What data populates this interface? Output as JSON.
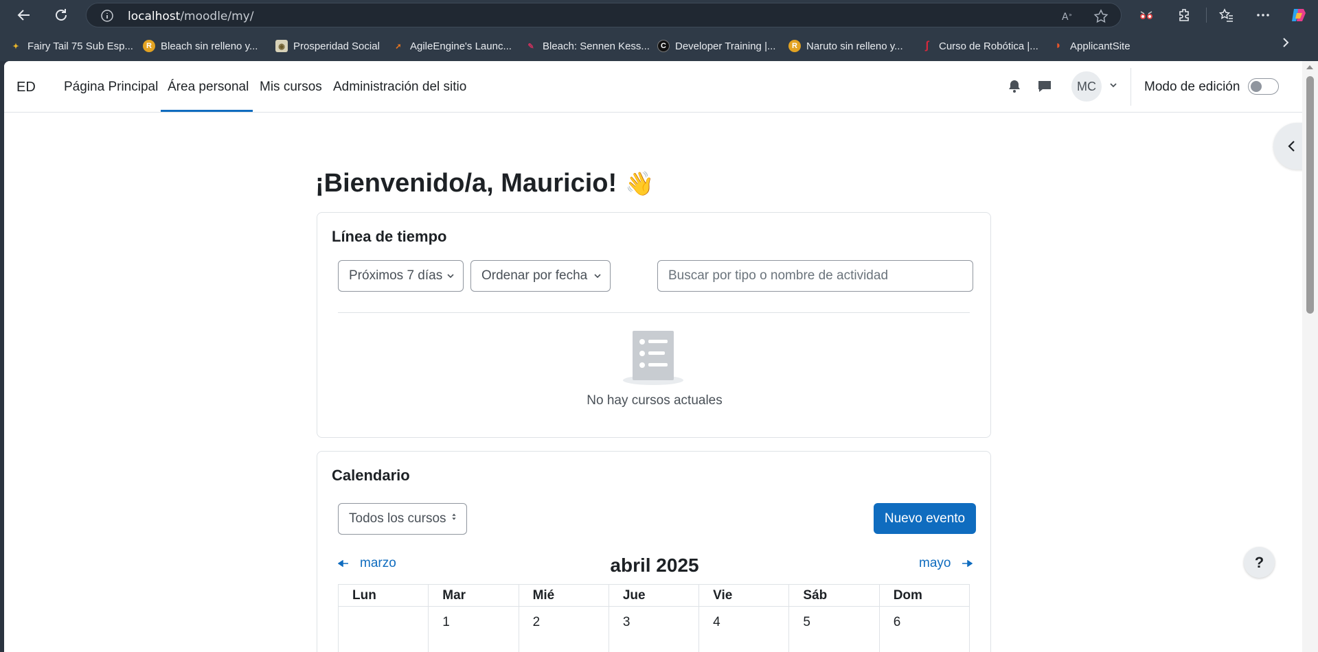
{
  "browser": {
    "url_host": "localhost",
    "url_path": "/moodle/my/",
    "bookmarks": [
      {
        "label": "Fairy Tail 75 Sub Esp...",
        "color": "#e9b52a",
        "glyph": "✦"
      },
      {
        "label": "Bleach sin relleno y...",
        "color": "#e3a322",
        "glyph": "R"
      },
      {
        "label": "Prosperidad Social",
        "color": "#d8d2b8",
        "glyph": "◉"
      },
      {
        "label": "AgileEngine's Launc...",
        "color": "#e9761f",
        "glyph": "➚"
      },
      {
        "label": "Bleach: Sennen Kess...",
        "color": "#c9315c",
        "glyph": "✎"
      },
      {
        "label": "Developer Training |...",
        "color": "#111111",
        "glyph": "C"
      },
      {
        "label": "Naruto sin relleno y...",
        "color": "#e3a322",
        "glyph": "R"
      },
      {
        "label": "Curso de Robótica |...",
        "color": "#d8283c",
        "glyph": "∫"
      },
      {
        "label": "ApplicantSite",
        "color": "#e8542a",
        "glyph": "◗"
      }
    ]
  },
  "navbar": {
    "brand": "ED",
    "links": [
      "Página Principal",
      "Área personal",
      "Mis cursos",
      "Administración del sitio"
    ],
    "user_initials": "MC",
    "edit_mode_label": "Modo de edición"
  },
  "page": {
    "welcome": "¡Bienvenido/a, Mauricio!",
    "wave_emoji": "👋"
  },
  "timeline": {
    "title": "Línea de tiempo",
    "filter_selected": "Próximos 7 días",
    "sort_selected": "Ordenar por fecha",
    "search_placeholder": "Buscar por tipo o nombre de actividad",
    "empty_message": "No hay cursos actuales"
  },
  "calendar": {
    "title": "Calendario",
    "course_selected": "Todos los cursos",
    "new_event_label": "Nuevo evento",
    "prev_month": "marzo",
    "next_month": "mayo",
    "current_month": "abril 2025",
    "weekdays": [
      "Lun",
      "Mar",
      "Mié",
      "Jue",
      "Vie",
      "Sáb",
      "Dom"
    ],
    "first_week": [
      "",
      "1",
      "2",
      "3",
      "4",
      "5",
      "6"
    ]
  },
  "help": {
    "label": "?"
  },
  "colors": {
    "primary": "#0f6cbf",
    "chrome": "#2f3a47"
  }
}
